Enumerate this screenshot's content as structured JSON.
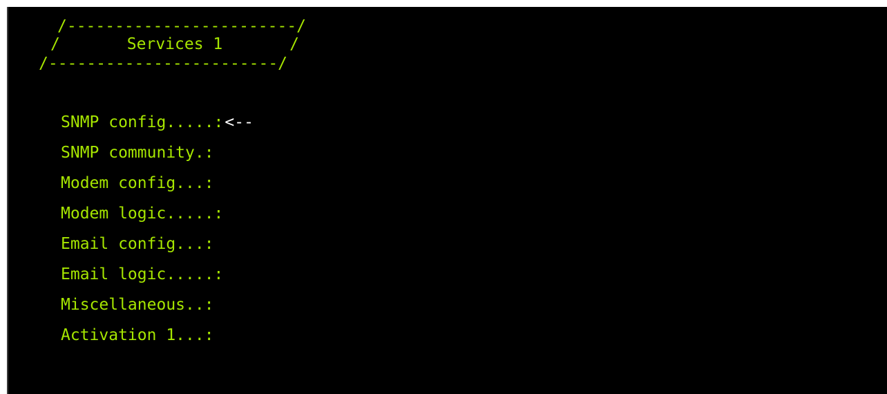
{
  "header": {
    "line1": "/------------------------/",
    "line2": "/       Services 1       /",
    "line3": "/------------------------/"
  },
  "menu": {
    "items": [
      {
        "label": "SNMP config.....:",
        "marker": "<--"
      },
      {
        "label": "SNMP community.:",
        "marker": ""
      },
      {
        "label": "Modem config...:",
        "marker": ""
      },
      {
        "label": "Modem logic.....:",
        "marker": ""
      },
      {
        "label": "Email config...:",
        "marker": ""
      },
      {
        "label": "Email logic.....:",
        "marker": ""
      },
      {
        "label": "Miscellaneous..:",
        "marker": ""
      },
      {
        "label": "Activation 1...:",
        "marker": ""
      }
    ],
    "selected_index": 0
  },
  "colors": {
    "background": "#000000",
    "text": "#a6e600",
    "marker": "#ffffff"
  }
}
